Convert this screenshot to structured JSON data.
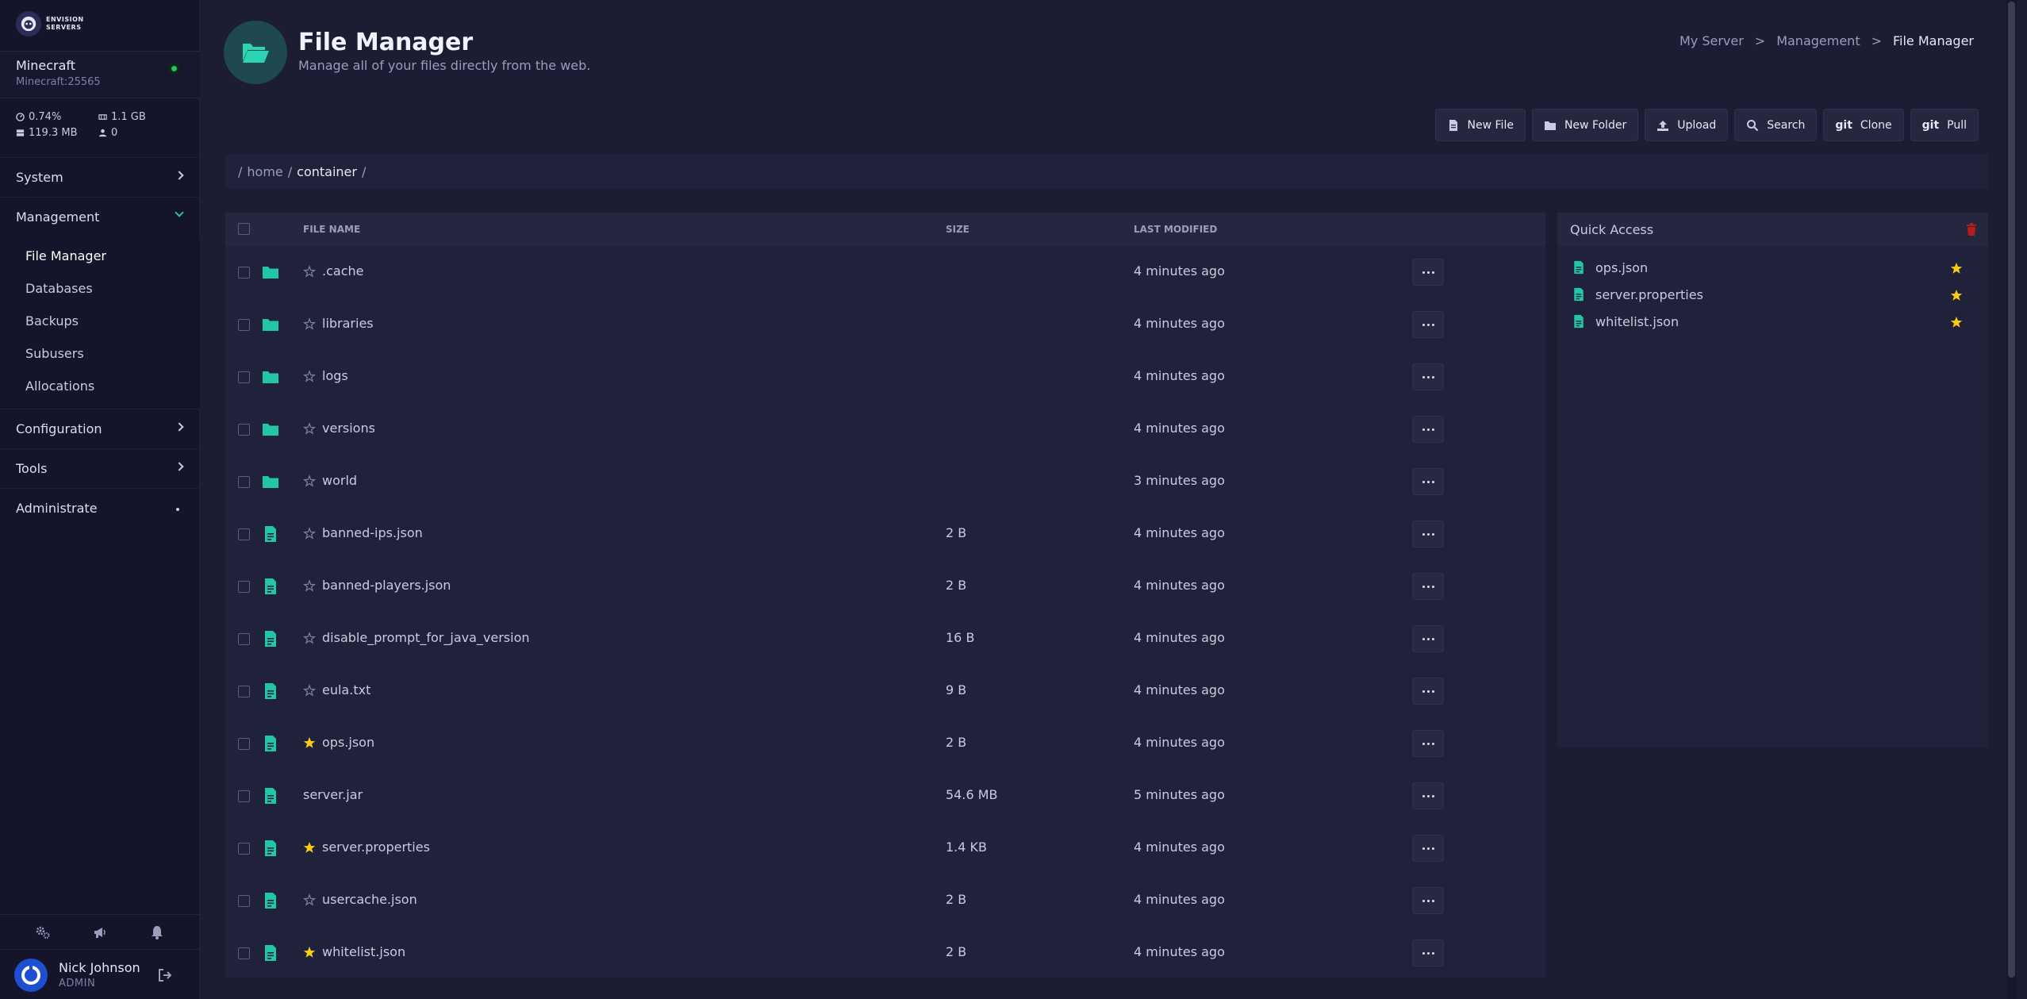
{
  "brand": {
    "line1": "ENVISION",
    "line2": "SERVERS"
  },
  "server": {
    "name": "Minecraft",
    "address": "Minecraft:25565"
  },
  "stats": {
    "cpu": "0.74%",
    "disk": "1.1 GB",
    "memory": "119.3 MB",
    "players": "0"
  },
  "nav": {
    "system": "System",
    "management": "Management",
    "management_items": [
      "File Manager",
      "Databases",
      "Backups",
      "Subusers",
      "Allocations"
    ],
    "configuration": "Configuration",
    "tools": "Tools",
    "administrate": "Administrate"
  },
  "user": {
    "name": "Nick Johnson",
    "role": "ADMIN"
  },
  "page": {
    "title": "File Manager",
    "subtitle": "Manage all of your files directly from the web."
  },
  "breadcrumb": [
    "My Server",
    "Management",
    "File Manager"
  ],
  "actions": {
    "new_file": "New File",
    "new_folder": "New Folder",
    "upload": "Upload",
    "search": "Search",
    "git": "git",
    "clone": "Clone",
    "pull": "Pull"
  },
  "path": {
    "root": "/",
    "home": "home",
    "sep": "/",
    "current": "container"
  },
  "table": {
    "headers": {
      "name": "FILE NAME",
      "size": "SIZE",
      "modified": "LAST MODIFIED"
    },
    "rows": [
      {
        "name": ".cache",
        "size": "",
        "modified": "4 minutes ago"
      },
      {
        "name": "libraries",
        "size": "",
        "modified": "4 minutes ago"
      },
      {
        "name": "logs",
        "size": "",
        "modified": "4 minutes ago"
      },
      {
        "name": "versions",
        "size": "",
        "modified": "4 minutes ago"
      },
      {
        "name": "world",
        "size": "",
        "modified": "3 minutes ago"
      },
      {
        "name": "banned-ips.json",
        "size": "2 B",
        "modified": "4 minutes ago"
      },
      {
        "name": "banned-players.json",
        "size": "2 B",
        "modified": "4 minutes ago"
      },
      {
        "name": "disable_prompt_for_java_version",
        "size": "16 B",
        "modified": "4 minutes ago"
      },
      {
        "name": "eula.txt",
        "size": "9 B",
        "modified": "4 minutes ago"
      },
      {
        "name": "ops.json",
        "size": "2 B",
        "modified": "4 minutes ago"
      },
      {
        "name": "server.jar",
        "size": "54.6 MB",
        "modified": "5 minutes ago"
      },
      {
        "name": "server.properties",
        "size": "1.4 KB",
        "modified": "4 minutes ago"
      },
      {
        "name": "usercache.json",
        "size": "2 B",
        "modified": "4 minutes ago"
      },
      {
        "name": "whitelist.json",
        "size": "2 B",
        "modified": "4 minutes ago"
      }
    ]
  },
  "quick_access": {
    "title": "Quick Access",
    "items": [
      "ops.json",
      "server.properties",
      "whitelist.json"
    ]
  },
  "colors": {
    "accent": "#22c5a8",
    "star": "#facc15",
    "online": "#22c55e",
    "danger": "#b91c1c"
  }
}
